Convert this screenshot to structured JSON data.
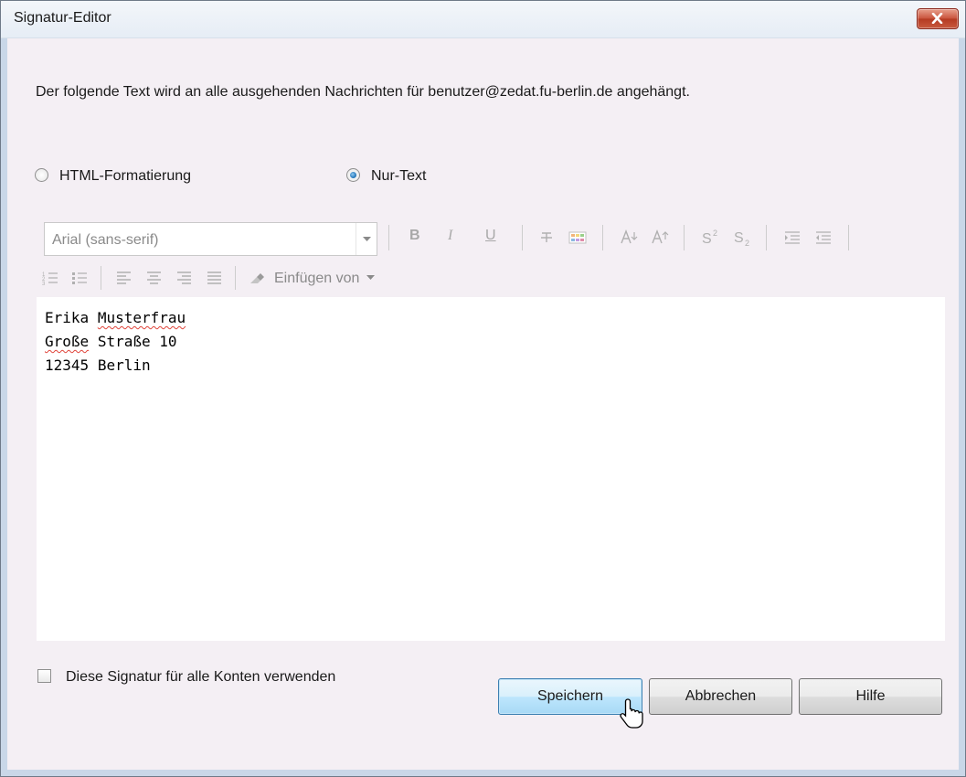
{
  "window": {
    "title": "Signatur-Editor"
  },
  "description": "Der folgende Text wird an alle ausgehenden Nachrichten für benutzer@zedat.fu-berlin.de angehängt.",
  "format_options": [
    {
      "label": "HTML-Formatierung",
      "checked": false
    },
    {
      "label": "Nur-Text",
      "checked": true
    }
  ],
  "toolbar": {
    "font_select": "Arial (sans-serif)",
    "bold": "B",
    "italic": "I",
    "underline": "U",
    "insert_from": "Einfügen von"
  },
  "signature_lines": [
    {
      "word1": "Erika",
      "word2": "Musterfrau"
    },
    {
      "word1": "Große",
      "word2": "Straße 10"
    },
    {
      "word1": "12345",
      "word2": "Berlin"
    }
  ],
  "use_for_all_accounts": {
    "label": "Diese Signatur für alle Konten verwenden",
    "checked": false
  },
  "buttons": {
    "save": "Speichern",
    "cancel": "Abbrechen",
    "help": "Hilfe"
  },
  "icons": {
    "close": "close-icon",
    "text_color": "text-color-icon",
    "highlight": "highlight-color-icon",
    "grow": "font-size-increase-icon",
    "shrink": "font-size-decrease-icon",
    "superscript": "superscript-icon",
    "subscript": "subscript-icon",
    "indent": "indent-icon",
    "outdent": "outdent-icon",
    "numbered_list": "numbered-list-icon",
    "bullet_list": "bullet-list-icon",
    "align_left": "align-left-icon",
    "align_center": "align-center-icon",
    "align_right": "align-right-icon",
    "justify": "align-justify-icon",
    "eraser": "eraser-icon",
    "cursor": "mouse-cursor-icon"
  }
}
